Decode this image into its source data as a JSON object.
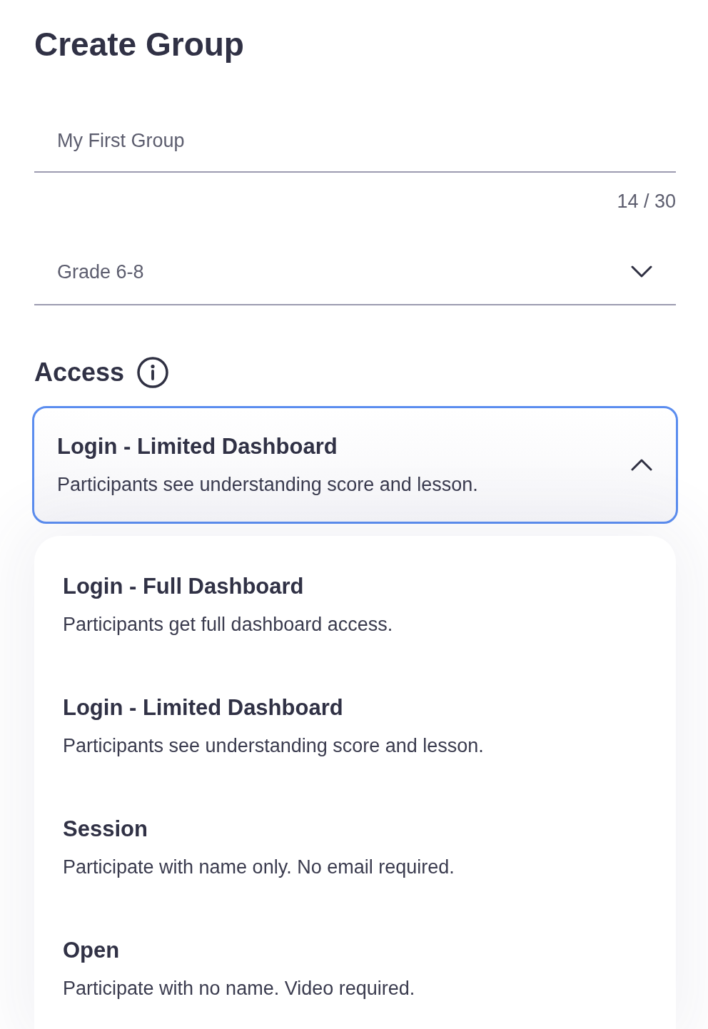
{
  "page": {
    "title": "Create Group"
  },
  "name_field": {
    "value": "My First Group",
    "counter": "14 / 30"
  },
  "grade_select": {
    "value": "Grade 6-8",
    "expanded": false
  },
  "access": {
    "heading": "Access",
    "select": {
      "title": "Login - Limited Dashboard",
      "description": "Participants see understanding score and lesson.",
      "expanded": true
    },
    "options": [
      {
        "title": "Login - Full Dashboard",
        "description": "Participants get full dashboard access."
      },
      {
        "title": "Login - Limited Dashboard",
        "description": "Participants see understanding score and lesson."
      },
      {
        "title": "Session",
        "description": "Participate with name only. No email required."
      },
      {
        "title": "Open",
        "description": "Participate with no name. Video required."
      }
    ]
  }
}
